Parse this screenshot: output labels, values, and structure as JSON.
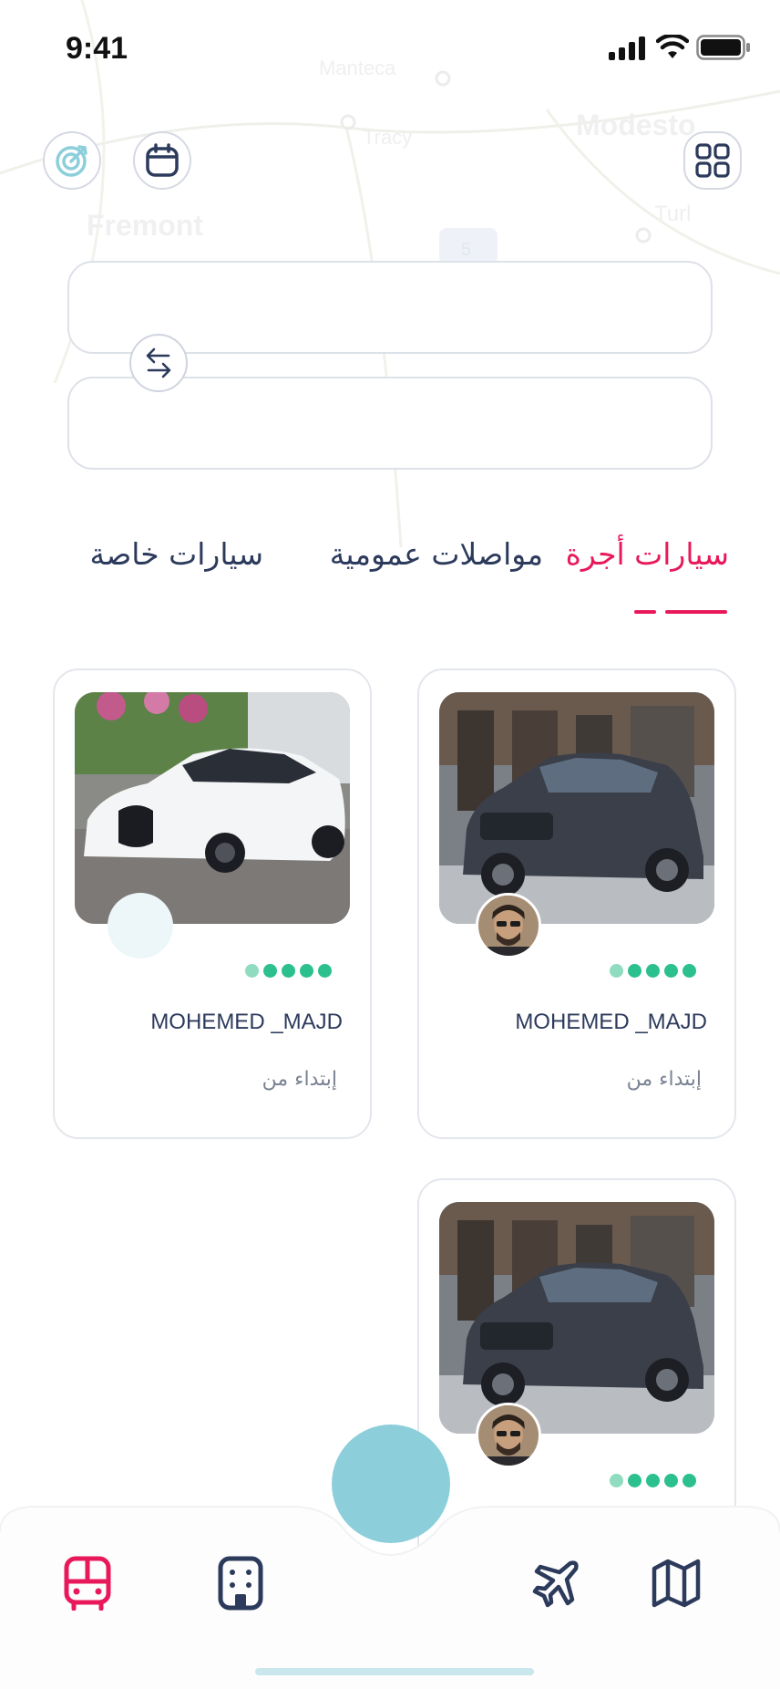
{
  "status_bar": {
    "time": "9:41"
  },
  "header": {
    "location_icon": "location-target-icon",
    "calendar_icon": "calendar-icon",
    "menu_icon": "grid-menu-icon"
  },
  "map": {
    "labels": [
      "Manteca",
      "Tracy",
      "Modesto",
      "Fremont",
      "Turl",
      "5"
    ]
  },
  "search": {
    "from_value": "",
    "to_value": "",
    "swap_icon": "swap-arrows-icon"
  },
  "tabs": [
    {
      "label": "سيارات أجرة",
      "active": true
    },
    {
      "label": "مواصلات عمومية",
      "active": false
    },
    {
      "label": "سيارات خاصة",
      "active": false
    }
  ],
  "cards": [
    {
      "driver": "MOHEMED _MAJD",
      "price_label": "إبتداء من",
      "rating": 4,
      "car": "volvo-suv",
      "has_avatar": true
    },
    {
      "driver": "MOHEMED _MAJD",
      "price_label": "إبتداء من",
      "rating": 4,
      "car": "white-supercar",
      "has_avatar": false
    },
    {
      "driver": "",
      "price_label": "",
      "rating": 4,
      "car": "volvo-suv",
      "has_avatar": true
    }
  ],
  "bottom_nav": {
    "items": [
      {
        "icon": "bus-icon",
        "active": true
      },
      {
        "icon": "building-icon",
        "active": false
      },
      {
        "icon": "plane-icon",
        "active": false
      },
      {
        "icon": "map-icon",
        "active": false
      }
    ]
  },
  "colors": {
    "accent": "#e8195a",
    "text": "#2c3a5c",
    "rating": "#2bc08e",
    "fab": "#8ccfdb"
  }
}
